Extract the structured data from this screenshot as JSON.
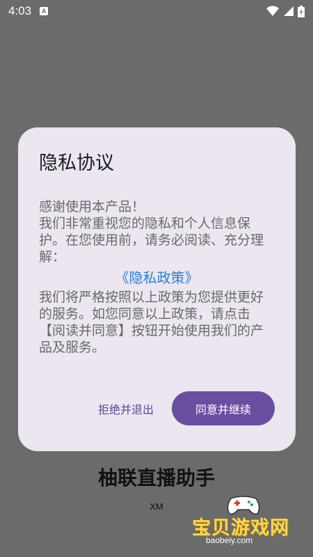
{
  "status": {
    "time": "4:03",
    "a_badge": "A"
  },
  "dialog": {
    "title": "隐私协议",
    "intro": "感谢使用本产品！\n我们非常重视您的隐私和个人信息保护。在您使用前，请务必阅读、充分理解：",
    "policy_link": "《隐私政策》",
    "body": "我们将严格按照以上政策为您提供更好的服务。如您同意以上政策，请点击【阅读并同意】按钮开始使用我们的产品及服务。",
    "decline_label": "拒绝并退出",
    "accept_label": "同意并继续"
  },
  "app": {
    "name": "柚联直播助手",
    "sub": "XM"
  },
  "watermark": {
    "text": "宝贝游戏网",
    "url": "baobeiy.com"
  },
  "colors": {
    "accent": "#6a4ea1",
    "link": "#2b7fd7",
    "dialog_bg": "#ebe6f0",
    "scrim": "#6b6b6b"
  }
}
